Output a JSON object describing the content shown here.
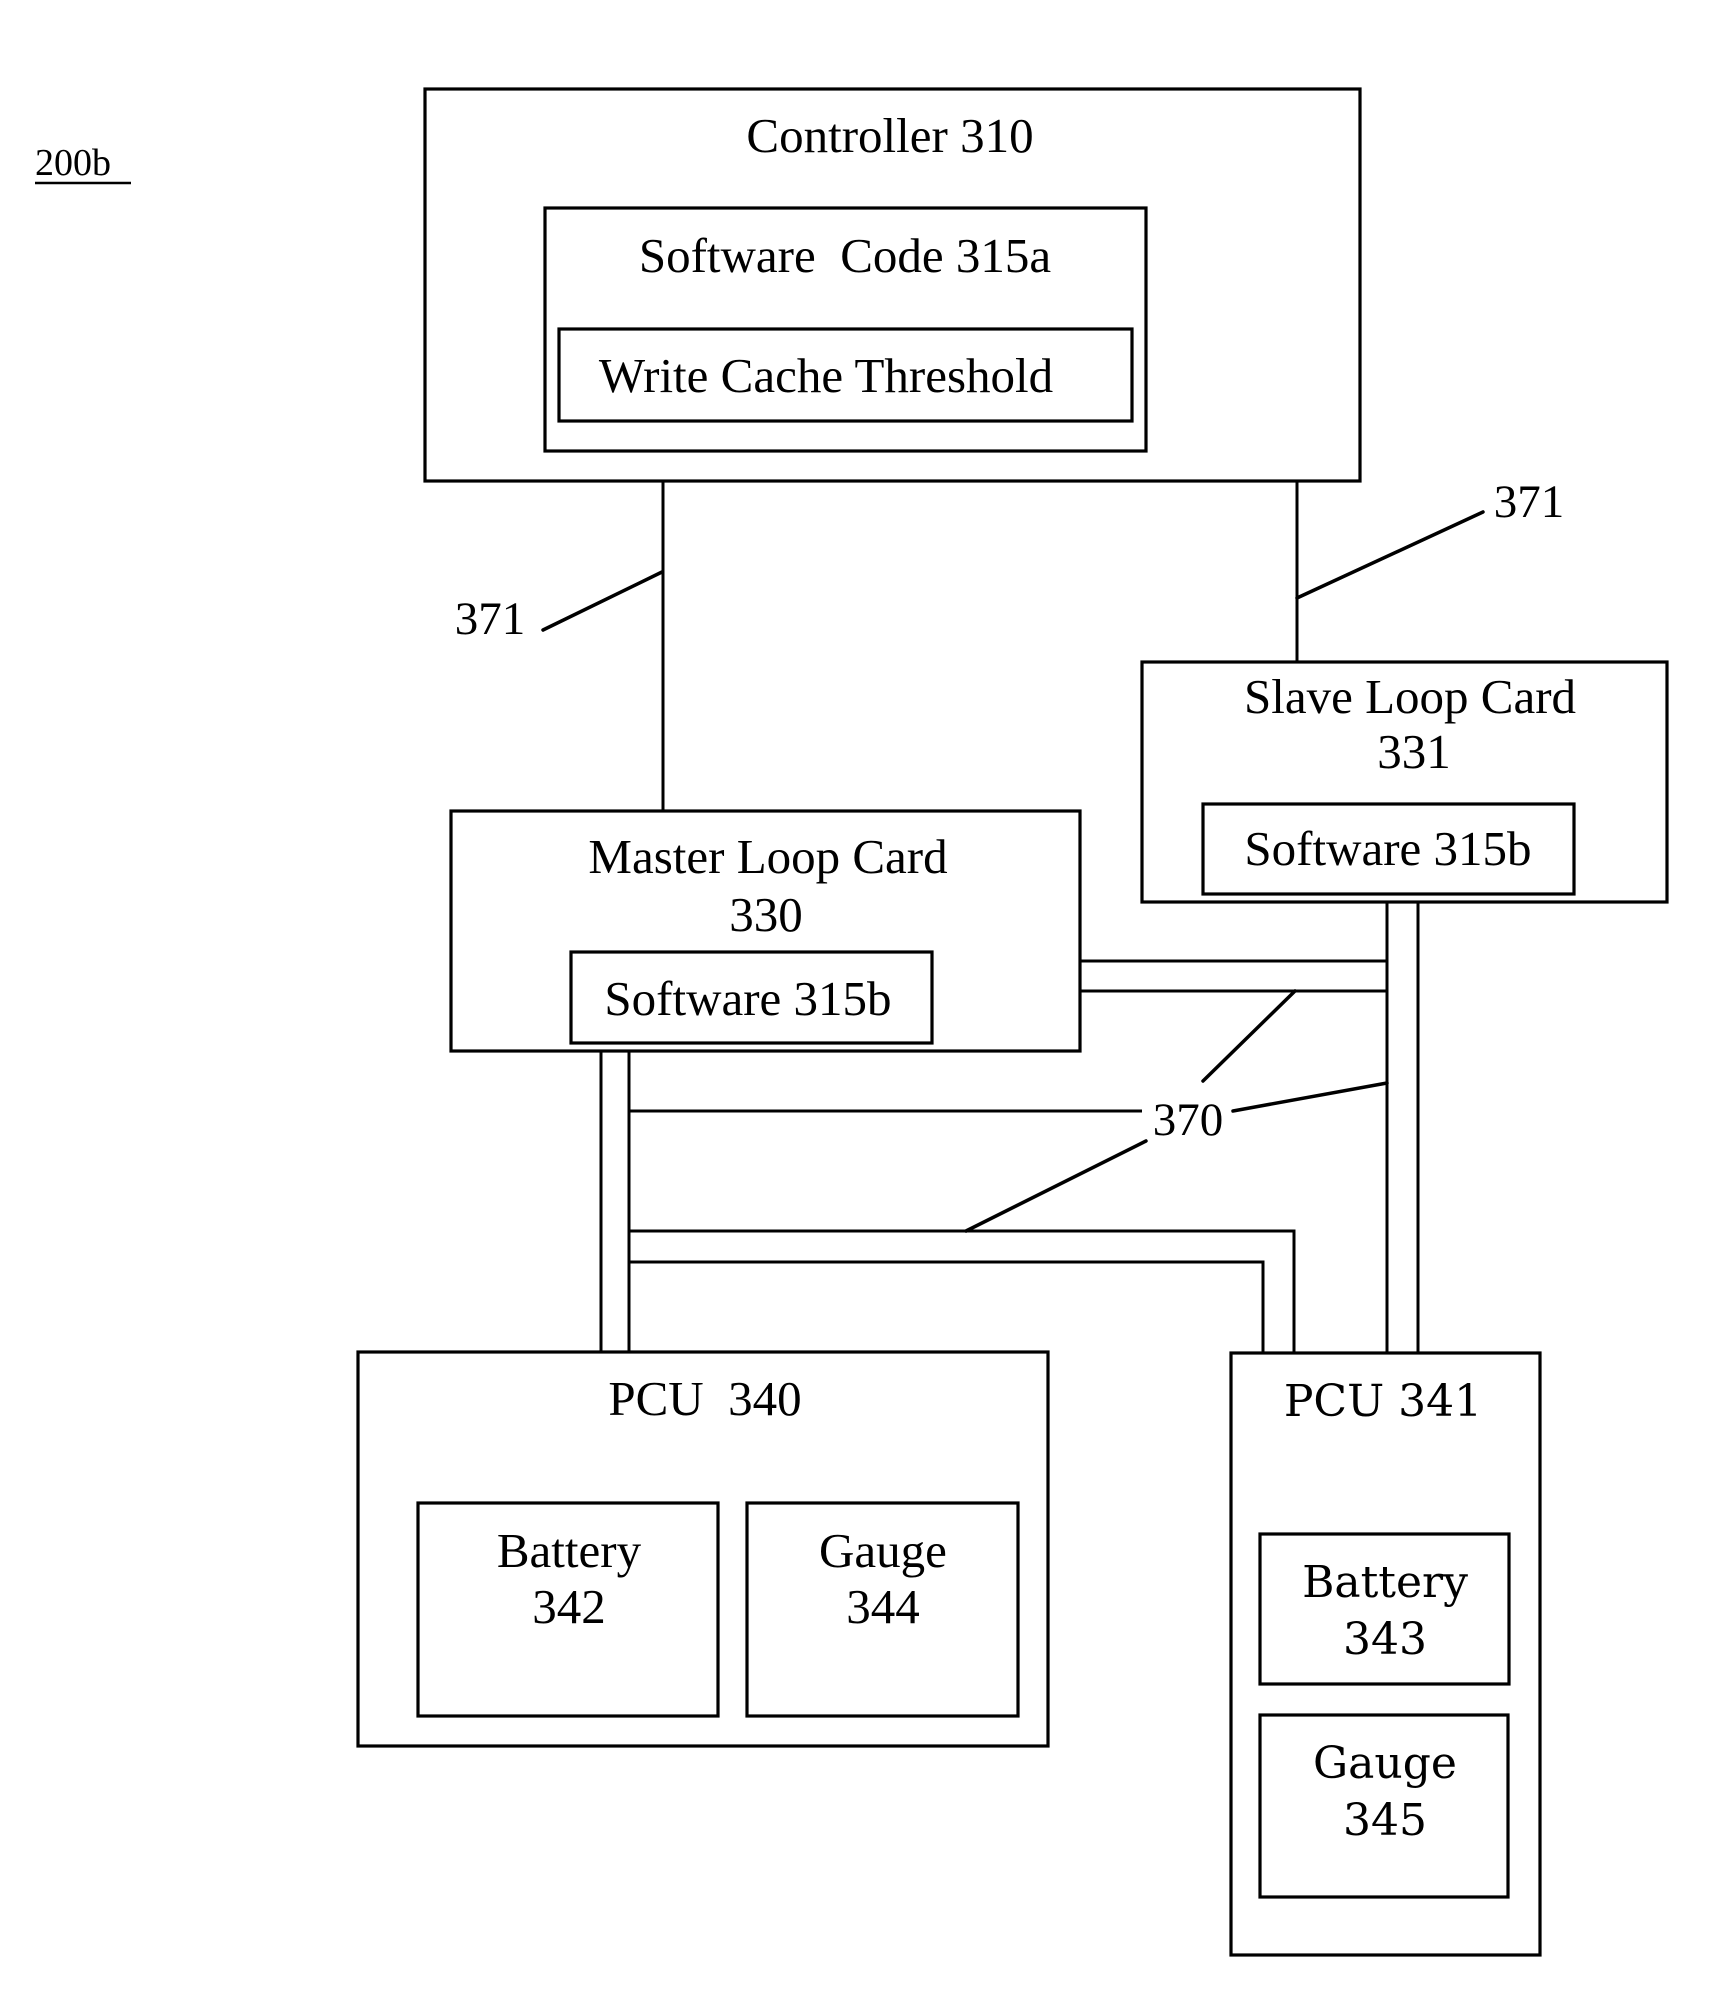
{
  "figure": {
    "label": "200b"
  },
  "controller": {
    "title": "Controller 310",
    "software": {
      "title": "Software  Code 315a",
      "threshold": "Write Cache Threshold"
    }
  },
  "master_loop_card": {
    "title_line1": "Master Loop Card",
    "title_line2": "330",
    "software": "Software 315b"
  },
  "slave_loop_card": {
    "title_line1": "Slave Loop Card",
    "title_line2": "331",
    "software": "Software 315b"
  },
  "pcu_340": {
    "title": "PCU  340",
    "battery": {
      "line1": "Battery",
      "line2": "342"
    },
    "gauge": {
      "line1": "Gauge",
      "line2": "344"
    }
  },
  "pcu_341": {
    "title": "PCU 341",
    "battery": {
      "line1": "Battery",
      "line2": "343"
    },
    "gauge": {
      "line1": "Gauge",
      "line2": "345"
    }
  },
  "reference_labels": {
    "controller_link_left": "371",
    "controller_link_right": "371",
    "loop_bus": "370"
  }
}
